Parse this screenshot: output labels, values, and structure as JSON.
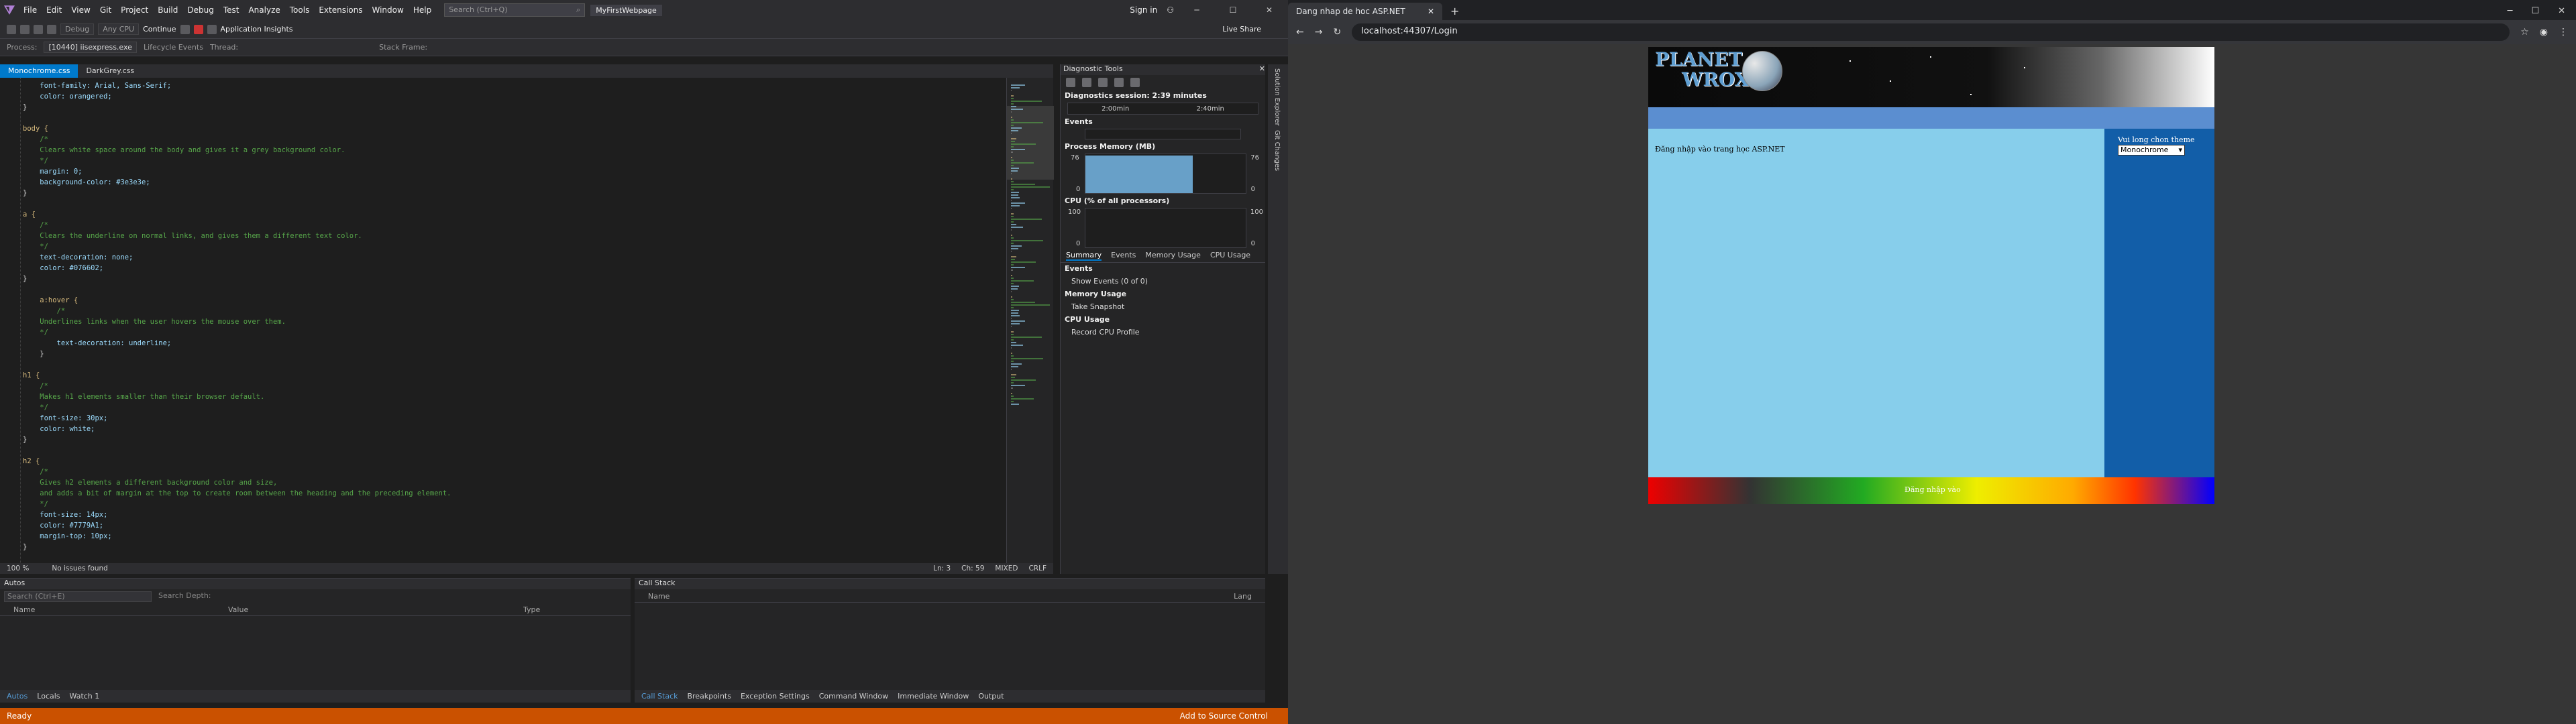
{
  "vs": {
    "menu": [
      "File",
      "Edit",
      "View",
      "Git",
      "Project",
      "Build",
      "Debug",
      "Test",
      "Analyze",
      "Tools",
      "Extensions",
      "Window",
      "Help"
    ],
    "search_placeholder": "Search (Ctrl+Q)",
    "project_name": "MyFirstWebpage",
    "sign_in": "Sign in",
    "toolbar": {
      "config": "Debug",
      "platform": "Any CPU",
      "continue": "Continue",
      "app_insights": "Application Insights",
      "live_share": "Live Share",
      "lifecycle": "Lifecycle Events",
      "thread": "Thread:",
      "stack_frame": "Stack Frame:"
    },
    "process_label": "Process:",
    "process_value": "[10440] iisexpress.exe",
    "tabs": [
      {
        "label": "Monochrome.css",
        "active": true
      },
      {
        "label": "DarkGrey.css",
        "active": false
      }
    ],
    "code": [
      {
        "t": "    font-family: Arial, Sans-Serif;",
        "c": "prop"
      },
      {
        "t": "    color: orangered;",
        "c": "prop"
      },
      {
        "t": "}",
        "c": "pun"
      },
      {
        "t": "",
        "c": "pun"
      },
      {
        "t": "body {",
        "c": "sel"
      },
      {
        "t": "    /*",
        "c": "cmt"
      },
      {
        "t": "    Clears white space around the body and gives it a grey background color.",
        "c": "cmt"
      },
      {
        "t": "    */",
        "c": "cmt"
      },
      {
        "t": "    margin: 0;",
        "c": "prop"
      },
      {
        "t": "    background-color: #3e3e3e;",
        "c": "prop"
      },
      {
        "t": "}",
        "c": "pun"
      },
      {
        "t": "",
        "c": "pun"
      },
      {
        "t": "a {",
        "c": "sel"
      },
      {
        "t": "    /*",
        "c": "cmt"
      },
      {
        "t": "    Clears the underline on normal links, and gives them a different text color.",
        "c": "cmt"
      },
      {
        "t": "    */",
        "c": "cmt"
      },
      {
        "t": "    text-decoration: none;",
        "c": "prop"
      },
      {
        "t": "    color: #076602;",
        "c": "prop"
      },
      {
        "t": "}",
        "c": "pun"
      },
      {
        "t": "",
        "c": "pun"
      },
      {
        "t": "    a:hover {",
        "c": "sel"
      },
      {
        "t": "        /*",
        "c": "cmt"
      },
      {
        "t": "    Underlines links when the user hovers the mouse over them.",
        "c": "cmt"
      },
      {
        "t": "    */",
        "c": "cmt"
      },
      {
        "t": "        text-decoration: underline;",
        "c": "prop"
      },
      {
        "t": "    }",
        "c": "pun"
      },
      {
        "t": "",
        "c": "pun"
      },
      {
        "t": "h1 {",
        "c": "sel"
      },
      {
        "t": "    /*",
        "c": "cmt"
      },
      {
        "t": "    Makes h1 elements smaller than their browser default.",
        "c": "cmt"
      },
      {
        "t": "    */",
        "c": "cmt"
      },
      {
        "t": "    font-size: 30px;",
        "c": "prop"
      },
      {
        "t": "    color: white;",
        "c": "prop"
      },
      {
        "t": "}",
        "c": "pun"
      },
      {
        "t": "",
        "c": "pun"
      },
      {
        "t": "h2 {",
        "c": "sel"
      },
      {
        "t": "    /*",
        "c": "cmt"
      },
      {
        "t": "    Gives h2 elements a different background color and size,",
        "c": "cmt"
      },
      {
        "t": "    and adds a bit of margin at the top to create room between the heading and the preceding element.",
        "c": "cmt"
      },
      {
        "t": "    */",
        "c": "cmt"
      },
      {
        "t": "    font-size: 14px;",
        "c": "prop"
      },
      {
        "t": "    color: #7779A1;",
        "c": "prop"
      },
      {
        "t": "    margin-top: 10px;",
        "c": "prop"
      },
      {
        "t": "}",
        "c": "pun"
      }
    ],
    "editor_status": {
      "zoom": "100 %",
      "issues": "No issues found",
      "ln": "Ln: 3",
      "ch": "Ch: 59",
      "mixed": "MIXED",
      "eol": "CRLF"
    },
    "diag": {
      "title": "Diagnostic Tools",
      "session": "Diagnostics session: 2:39 minutes",
      "t1": "2:00min",
      "t2": "2:40min",
      "events": "Events",
      "memory": "Process Memory (MB)",
      "mem_top": "76",
      "mem_bot": "0",
      "mem_fill": 0.86,
      "cpu": "CPU (% of all processors)",
      "cpu_top": "100",
      "cpu_bot": "0",
      "tabs": [
        "Summary",
        "Events",
        "Memory Usage",
        "CPU Usage"
      ],
      "s_events": "Events",
      "show_events": "Show Events (0 of 0)",
      "s_mem": "Memory Usage",
      "snapshot": "Take Snapshot",
      "s_cpu": "CPU Usage",
      "record": "Record CPU Profile"
    },
    "side_tabs": [
      "Solution Explorer",
      "Git Changes"
    ],
    "autos": {
      "title": "Autos",
      "search": "Search (Ctrl+E)",
      "depth": "Search Depth:",
      "cols": [
        "Name",
        "Value",
        "Type"
      ],
      "tabs": [
        "Autos",
        "Locals",
        "Watch 1"
      ]
    },
    "callstack": {
      "title": "Call Stack",
      "cols": [
        "Name",
        "Lang"
      ],
      "tabs": [
        "Call Stack",
        "Breakpoints",
        "Exception Settings",
        "Command Window",
        "Immediate Window",
        "Output"
      ]
    },
    "status": {
      "ready": "Ready",
      "source": "Add to Source Control"
    }
  },
  "browser": {
    "tab_title": "Dang nhap de hoc ASP.NET",
    "url": "localhost:44307/Login",
    "site_heading": "Đăng nhập vào trang học ASP.NET",
    "theme_label": "Vui long chon theme",
    "theme_value": "Monochrome",
    "footer": "Đăng nhập vào",
    "logo_top": "PLANET",
    "logo_bottom": "WROX"
  }
}
